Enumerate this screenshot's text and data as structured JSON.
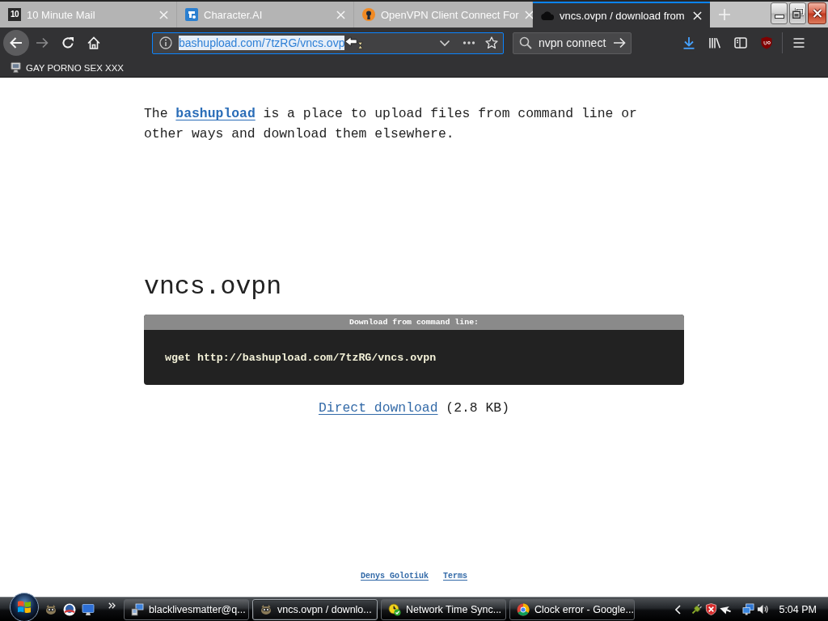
{
  "tabs": [
    {
      "favicon_text": "10",
      "title": "10 Minute Mail",
      "selected": false
    },
    {
      "title": "Character.AI",
      "selected": false
    },
    {
      "title": "OpenVPN Client Connect For",
      "selected": false
    },
    {
      "title": "vncs.ovpn / download from",
      "selected": true
    }
  ],
  "toolbar": {
    "url": {
      "value": "bashupload.com/7tzRG/vncs.ovp",
      "selected": true
    },
    "search": {
      "value": "nvpn connect"
    }
  },
  "bookmarks": [
    {
      "label": "GAY PORNO SEX XXX"
    }
  ],
  "page": {
    "intro": {
      "before": "The",
      "link": "bashupload",
      "after": "is a place to upload files from command line or other ways and download them elsewhere."
    },
    "file_name": "vncs.ovpn",
    "command_box": {
      "header": "Download from command line:",
      "command": "wget http://bashupload.com/7tzRG/vncs.ovpn"
    },
    "download": {
      "link": "Direct download",
      "size": "(2.8 KB)"
    },
    "footer_links": [
      "Denys Golotiuk",
      "Terms"
    ]
  },
  "taskbar": {
    "tasks": [
      {
        "label": "blacklivesmatter@q...",
        "selected": false
      },
      {
        "label": "vncs.ovpn / downlo...",
        "selected": true
      },
      {
        "label": "Network Time Sync...",
        "selected": false
      },
      {
        "label": "Clock error - Google...",
        "selected": false
      }
    ],
    "clock": "5:04 PM"
  }
}
